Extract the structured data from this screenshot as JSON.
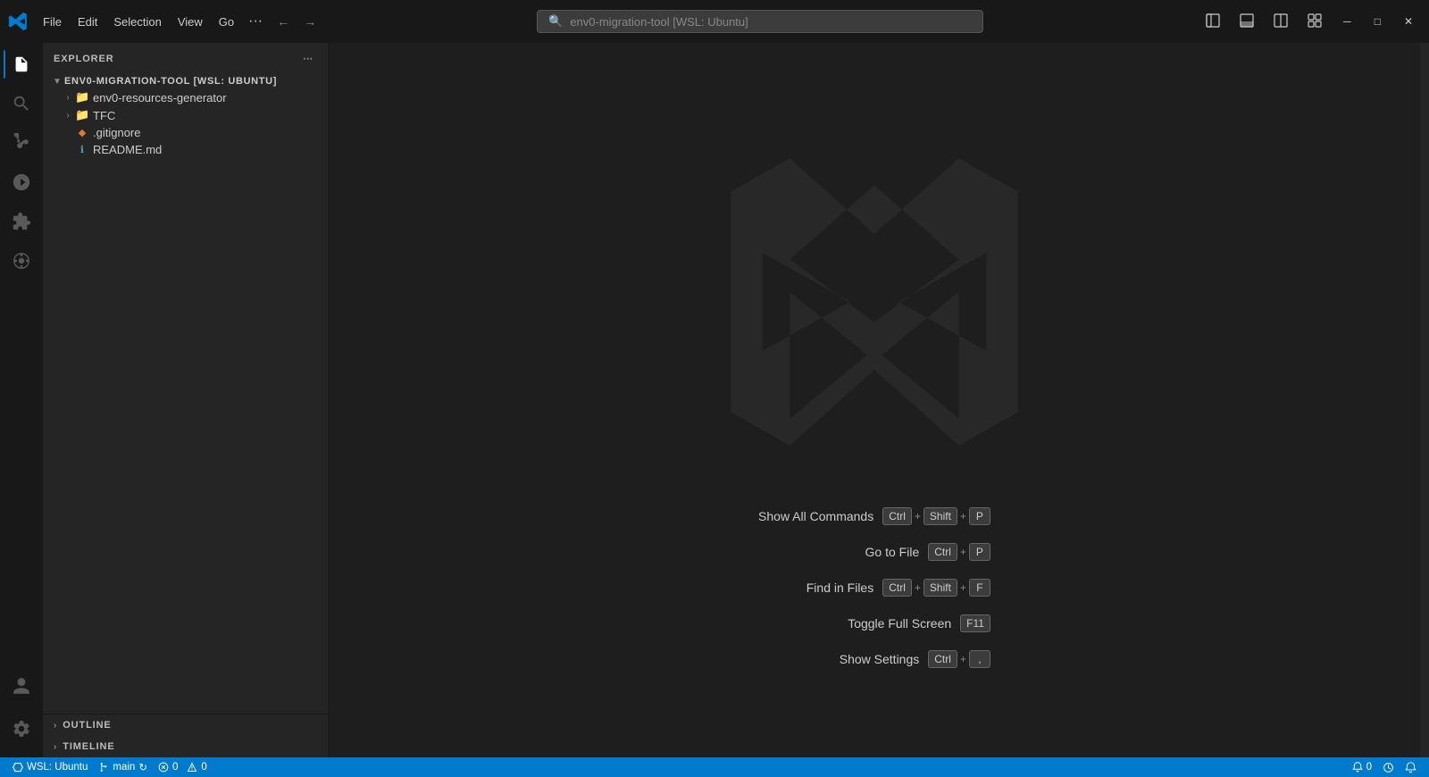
{
  "titlebar": {
    "menu_file": "File",
    "menu_edit": "Edit",
    "menu_selection": "Selection",
    "menu_view": "View",
    "menu_go": "Go",
    "menu_dots": "···",
    "search_text": "env0-migration-tool [WSL: Ubuntu]",
    "nav_back": "←",
    "nav_forward": "→"
  },
  "sidebar": {
    "explorer_label": "EXPLORER",
    "root_folder": "ENV0-MIGRATION-TOOL [WSL: UBUNTU]",
    "items": [
      {
        "type": "folder",
        "name": "env0-resources-generator",
        "indent": 1,
        "expanded": false
      },
      {
        "type": "folder",
        "name": "TFC",
        "indent": 1,
        "expanded": false
      },
      {
        "type": "file",
        "name": ".gitignore",
        "indent": 1,
        "icon": "◆"
      },
      {
        "type": "file",
        "name": "README.md",
        "indent": 1,
        "icon": "ℹ"
      }
    ],
    "outline_label": "OUTLINE",
    "timeline_label": "TIMELINE"
  },
  "shortcuts": [
    {
      "label": "Show All Commands",
      "keys": [
        "Ctrl",
        "+",
        "Shift",
        "+",
        "P"
      ]
    },
    {
      "label": "Go to File",
      "keys": [
        "Ctrl",
        "+",
        "P"
      ]
    },
    {
      "label": "Find in Files",
      "keys": [
        "Ctrl",
        "+",
        "Shift",
        "+",
        "F"
      ]
    },
    {
      "label": "Toggle Full Screen",
      "keys": [
        "F11"
      ]
    },
    {
      "label": "Show Settings",
      "keys": [
        "Ctrl",
        "+",
        ","
      ]
    }
  ],
  "statusbar": {
    "wsl": "WSL: Ubuntu",
    "branch": "main",
    "sync_icon": "↻",
    "errors": "0",
    "warnings": "0",
    "notifications": "0",
    "bell_icon": "🔔",
    "history_icon": "🕐"
  }
}
